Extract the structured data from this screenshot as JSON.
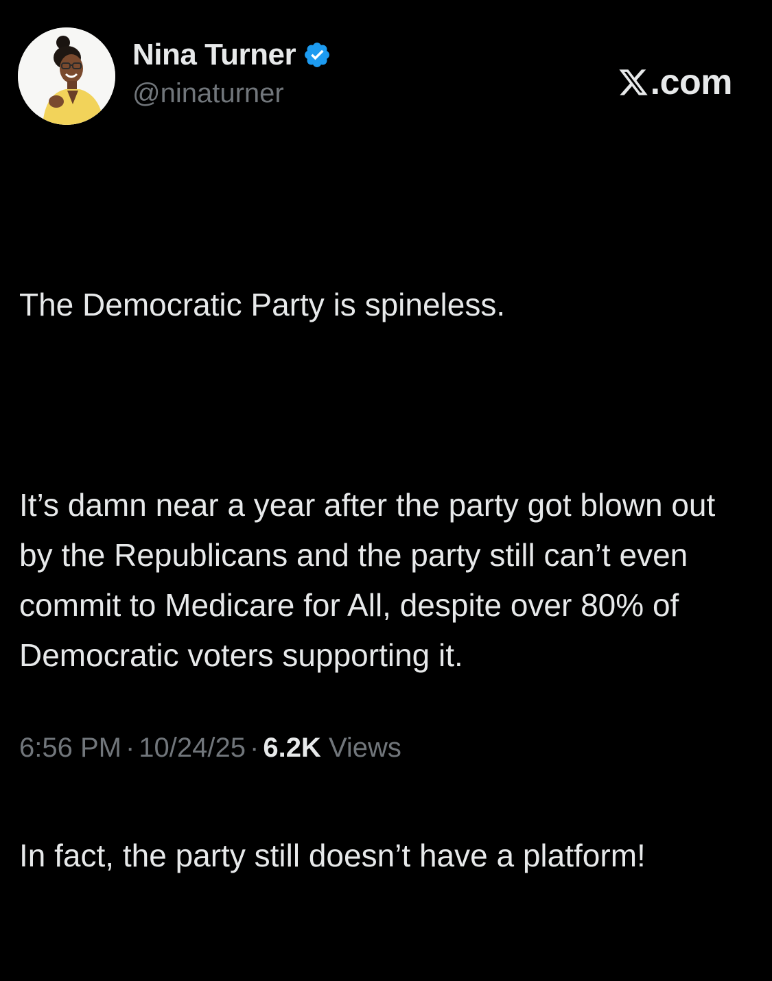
{
  "author": {
    "display_name": "Nina Turner",
    "handle": "@ninaturner",
    "verified": true,
    "verified_color": "#1d9bf0"
  },
  "brand": {
    "logo_icon": "x-logo-icon",
    "suffix": ".com"
  },
  "tweet": {
    "paragraphs": [
      "The Democratic Party is spineless.",
      "It’s damn near a year after the party got blown out by the Republicans and the party still can’t even commit to Medicare for All, despite over 80% of Democratic voters supporting it.",
      "In fact, the party still doesn’t have a platform!"
    ]
  },
  "meta": {
    "time": "6:56 PM",
    "separator": "·",
    "date": "10/24/25",
    "views_count": "6.2K",
    "views_label": "Views"
  },
  "colors": {
    "background": "#000000",
    "text_primary": "#e7e9ea",
    "text_secondary": "#71767b"
  }
}
